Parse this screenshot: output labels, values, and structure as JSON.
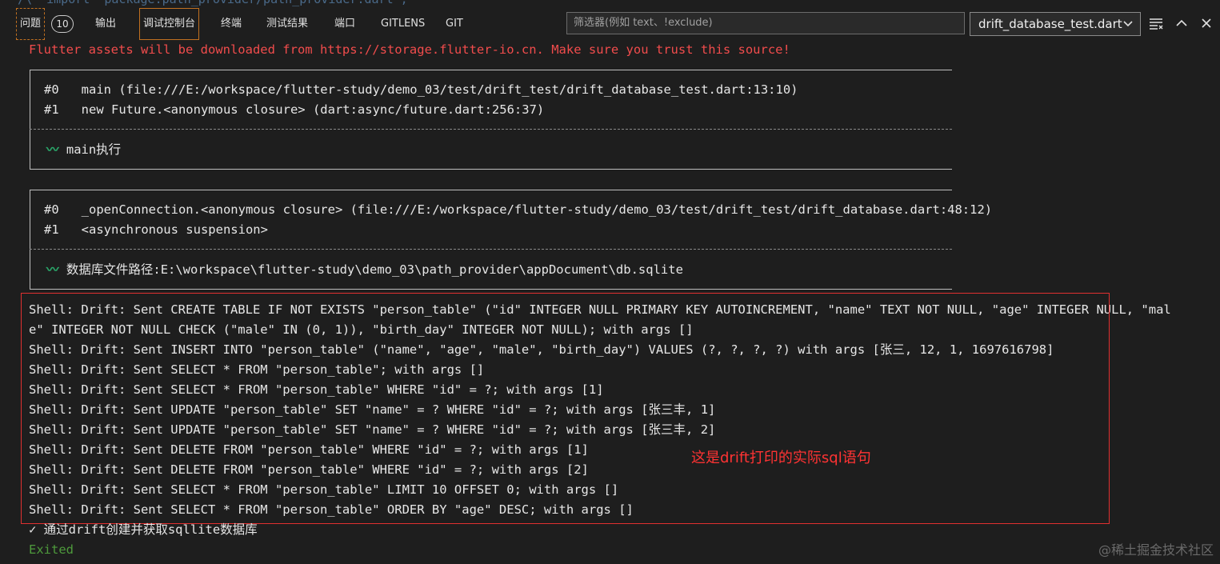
{
  "panel": {
    "ghost_code": "/\\  import 'package:path_provider/path_provider.dart';",
    "tabs": {
      "problems": "问题",
      "problems_count": "10",
      "output": "输出",
      "debug_console": "调试控制台",
      "terminal": "终端",
      "test_results": "测试结果",
      "ports": "端口",
      "gitlens": "GITLENS",
      "git": "GIT"
    },
    "filter_placeholder": "筛选器(例如 text、!exclude)",
    "selected_file": "drift_database_test.dart",
    "icons": {
      "chevron": "chevron-down-icon",
      "clear": "clear-console-icon",
      "maximize": "chevron-up-icon",
      "close": "close-icon"
    }
  },
  "console": {
    "warning": "Flutter assets will be downloaded from https://storage.flutter-io.cn. Make sure you trust this source!",
    "log1": {
      "frame0": "#0   main (file:///E:/workspace/flutter-study/demo_03/test/drift_test/drift_database_test.dart:13:10)",
      "frame1": "#1   new Future.<anonymous closure> (dart:async/future.dart:256:37)",
      "message": "main执行"
    },
    "log2": {
      "frame0": "#0   _openConnection.<anonymous closure> (file:///E:/workspace/flutter-study/demo_03/test/drift_test/drift_database.dart:48:12)",
      "frame1": "#1   <asynchronous suspension>",
      "message": "数据库文件路径:E:\\workspace\\flutter-study\\demo_03\\path_provider\\appDocument\\db.sqlite"
    },
    "shell_lines": [
      "Shell: Drift: Sent CREATE TABLE IF NOT EXISTS \"person_table\" (\"id\" INTEGER NULL PRIMARY KEY AUTOINCREMENT, \"name\" TEXT NOT NULL, \"age\" INTEGER NULL, \"mal",
      "e\" INTEGER NOT NULL CHECK (\"male\" IN (0, 1)), \"birth_day\" INTEGER NOT NULL); with args []",
      "Shell: Drift: Sent INSERT INTO \"person_table\" (\"name\", \"age\", \"male\", \"birth_day\") VALUES (?, ?, ?, ?) with args [张三, 12, 1, 1697616798]",
      "Shell: Drift: Sent SELECT * FROM \"person_table\"; with args []",
      "Shell: Drift: Sent SELECT * FROM \"person_table\" WHERE \"id\" = ?; with args [1]",
      "Shell: Drift: Sent UPDATE \"person_table\" SET \"name\" = ? WHERE \"id\" = ?; with args [张三丰, 1]",
      "Shell: Drift: Sent UPDATE \"person_table\" SET \"name\" = ? WHERE \"id\" = ?; with args [张三丰, 2]",
      "Shell: Drift: Sent DELETE FROM \"person_table\" WHERE \"id\" = ?; with args [1]",
      "Shell: Drift: Sent DELETE FROM \"person_table\" WHERE \"id\" = ?; with args [2]",
      "Shell: Drift: Sent SELECT * FROM \"person_table\" LIMIT 10 OFFSET 0; with args []",
      "Shell: Drift: Sent SELECT * FROM \"person_table\" ORDER BY \"age\" DESC; with args []"
    ],
    "test_pass": "✓ 通过drift创建并获取sqllite数据库",
    "exited": "Exited"
  },
  "annotation": "这是drift打印的实际sql语句",
  "watermark": "@稀土掘金技术社区",
  "colors": {
    "background": "#1e1e1e",
    "warning": "#f14c4c",
    "annotation_box": "#e03030",
    "exited": "#4e9a3c",
    "active_tab_border": "#c07020"
  }
}
